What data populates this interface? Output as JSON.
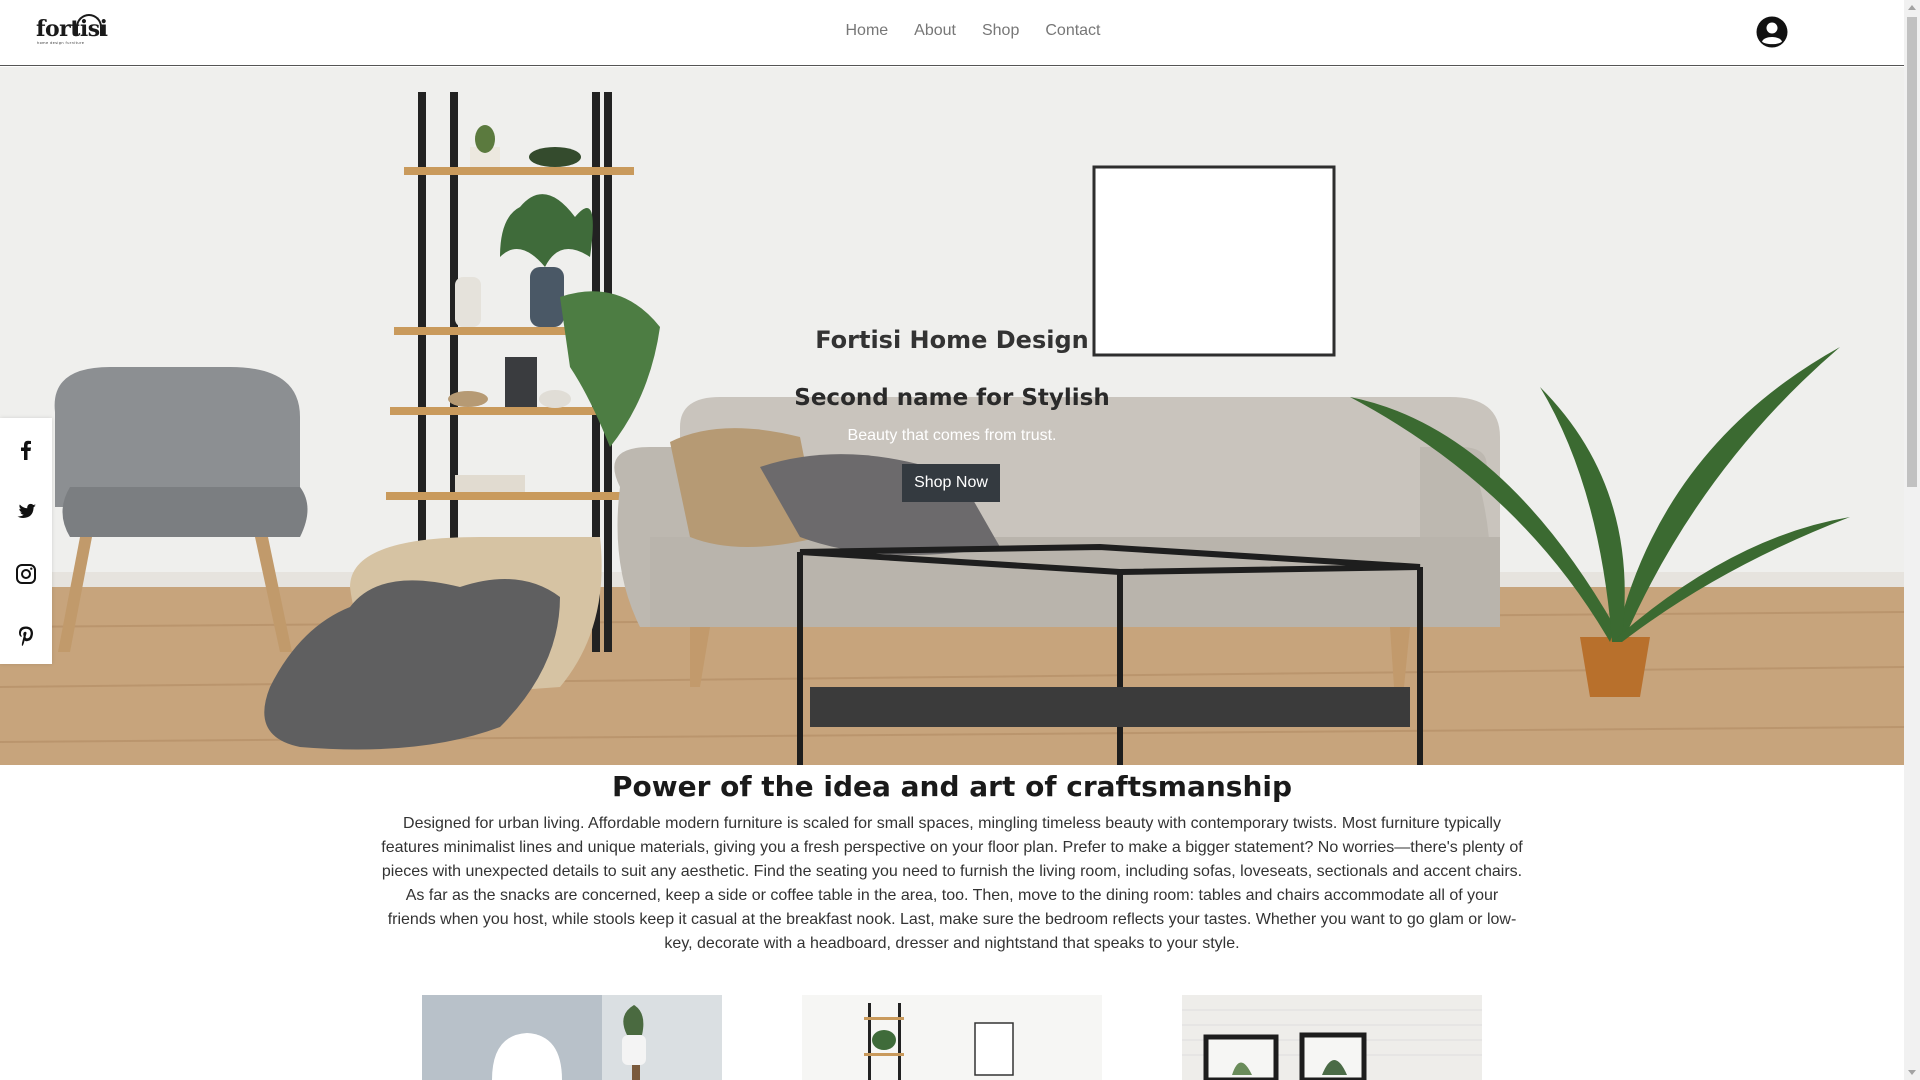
{
  "header": {
    "logo_text": "fortisi",
    "logo_tagline": "home design furniture",
    "nav": [
      {
        "label": "Home"
      },
      {
        "label": "About"
      },
      {
        "label": "Shop"
      },
      {
        "label": "Contact"
      }
    ],
    "account_icon": "user-circle-icon"
  },
  "hero": {
    "title": "Fortisi Home Design",
    "subtitle": "Second name for Stylish",
    "tagline": "Beauty that comes from trust.",
    "cta_label": "Shop Now"
  },
  "social": [
    {
      "icon": "facebook-icon"
    },
    {
      "icon": "twitter-icon"
    },
    {
      "icon": "instagram-icon"
    },
    {
      "icon": "pinterest-icon"
    }
  ],
  "about": {
    "title": "Power of the idea and art of craftsmanship",
    "body": "Designed for urban living. Affordable modern furniture is scaled for small spaces, mingling timeless beauty with contemporary twists. Most furniture typically features minimalist lines and unique materials, giving you a fresh perspective on your floor plan. Prefer to make a bigger statement? No worries—there's plenty of pieces with unexpected details to suit any aesthetic. Find the seating you need to furnish the living room, including sofas, loveseats, sectionals and accent chairs. As far as the snacks are concerned, keep a side or coffee table in the area, too. Then, move to the dining room: tables and chairs accommodate all of your friends when you host, while stools keep it casual at the breakfast nook. Last, make sure the bedroom reflects your tastes. Whether you want to go glam or low-key, decorate with a headboard, dresser and nightstand that speaks to your style."
  },
  "colors": {
    "button_bg": "#343a40",
    "nav_text": "#777777",
    "heading_text": "#1a1a1a"
  }
}
